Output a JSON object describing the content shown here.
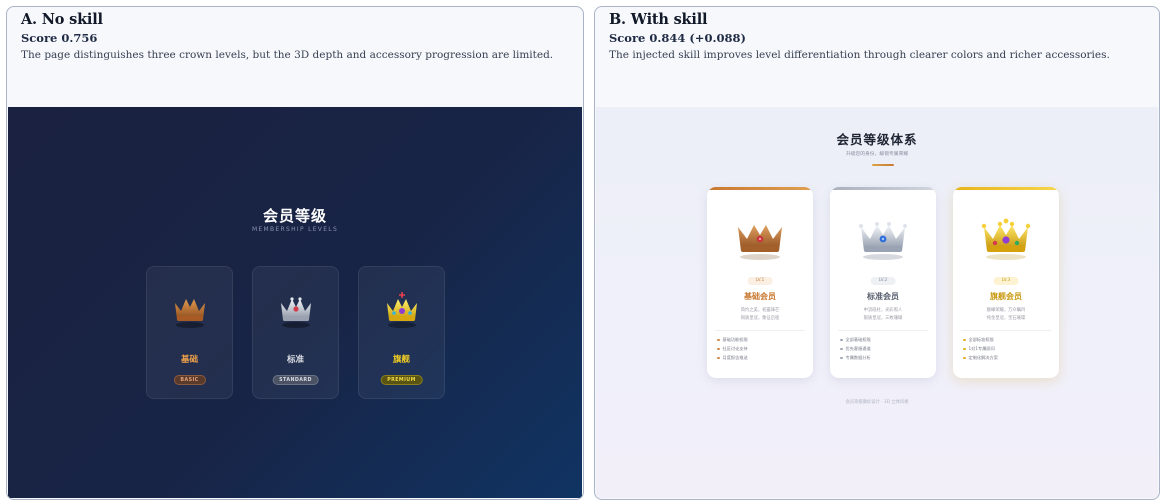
{
  "colors": {
    "bronze": "#c47f3d",
    "silver": "#b8bfca",
    "gold": "#f0c419",
    "dark_bg": "#182446",
    "light_bg": "#eceff7"
  },
  "panel_a": {
    "title": "A. No skill",
    "score": "Score 0.756",
    "description": "The page distinguishes three crown levels, but the 3D depth and accessory progression are limited.",
    "page": {
      "heading": "会员等级",
      "subheading": "MEMBERSHIP LEVELS",
      "cards": [
        {
          "name": "基础",
          "badge": "BASIC",
          "icon": "bronze-crown-icon"
        },
        {
          "name": "标准",
          "badge": "STANDARD",
          "icon": "silver-crown-icon"
        },
        {
          "name": "旗舰",
          "badge": "PREMIUM",
          "icon": "gold-crown-icon"
        }
      ]
    }
  },
  "panel_b": {
    "title": "B. With skill",
    "score": "Score 0.844 (+0.088)",
    "description": "The injected skill improves level differentiation through clearer colors and richer accessories.",
    "page": {
      "heading": "会员等级体系",
      "subheading": "升级您的身份，解锁专属荣耀",
      "footer": "会员等级徽标设计 · 3D 立体风格",
      "cards": [
        {
          "level": "LV.1",
          "name": "基础会员",
          "desc_line1": "简约之美，初露锋芒",
          "desc_line2": "铜质皇冠，象征启程",
          "features": [
            "基础功能权限",
            "社区讨论支持",
            "月度报告推送"
          ],
          "icon": "bronze-crown-icon"
        },
        {
          "level": "LV.2",
          "name": "标准会员",
          "desc_line1": "中流砥柱，光彩照人",
          "desc_line2": "银质皇冠，三枚珊瑚",
          "features": [
            "全部基础权限",
            "优先客服通道",
            "专属数据分析"
          ],
          "icon": "silver-crown-icon"
        },
        {
          "level": "LV.3",
          "name": "旗舰会员",
          "desc_line1": "巅峰荣耀，万众瞩目",
          "desc_line2": "纯金皇冠，宝石璀璨",
          "features": [
            "全部标准权限",
            "1对1专属顾问",
            "定制化解决方案"
          ],
          "icon": "gold-crown-icon"
        }
      ]
    }
  }
}
